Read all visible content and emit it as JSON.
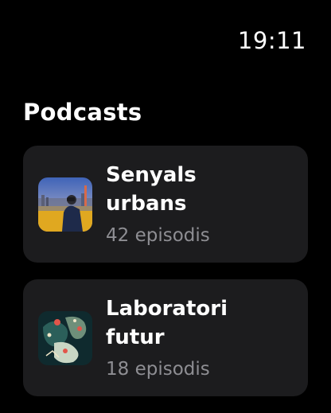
{
  "status": {
    "time": "19:11"
  },
  "header": {
    "title": "Podcasts"
  },
  "podcasts": [
    {
      "title_line1": "Senyals",
      "title_line2": "urbans",
      "episodes": "42 episodis",
      "artwork_icon": "city-photo-artwork"
    },
    {
      "title_line1": "Laboratori",
      "title_line2": "futur",
      "episodes": "18 episodis",
      "artwork_icon": "abstract-map-artwork"
    }
  ],
  "colors": {
    "background": "#000000",
    "card": "#1c1c1e",
    "secondary_text": "#8e8e93"
  }
}
